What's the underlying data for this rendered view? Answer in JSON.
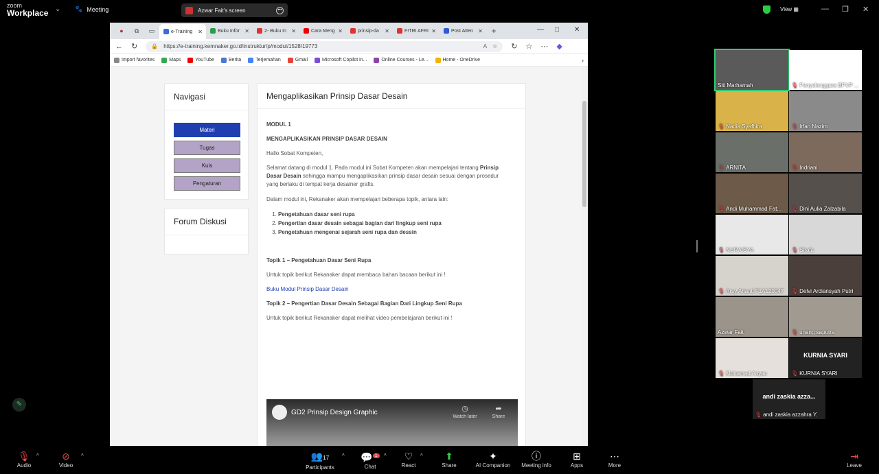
{
  "zoom": {
    "logo_line1": "zoom",
    "logo_line2": "Workplace",
    "meeting_label": "Meeting",
    "screen_share_label": "Azwar Fait's screen",
    "view_label": "View"
  },
  "browser": {
    "tabs": [
      "e-Training",
      "Buku Infor",
      "2- Buku In",
      "Cara Meng",
      "prinsip-da",
      "FITRI AFRI",
      "Post Atten"
    ],
    "url": "https://e-training.kemnaker.go.id/instruktur/p/modul/1528/19773",
    "favorites": [
      "Import favorites",
      "Maps",
      "YouTube",
      "Berita",
      "Terjemahan",
      "Gmail",
      "Microsoft Copilot in...",
      "Online Courses - Le...",
      "Home - OneDrive"
    ]
  },
  "nav_card": {
    "title": "Navigasi",
    "buttons": [
      "Materi",
      "Tugas",
      "Kuis",
      "Pengaturan"
    ]
  },
  "forum_card": {
    "title": "Forum Diskusi"
  },
  "module": {
    "title": "Mengaplikasikan Prinsip Dasar Desain",
    "label": "MODUL 1",
    "heading": "MENGAPLIKASIKAN PRINSIP DASAR DESAIN",
    "greeting": "Hallo Sobat Kompeten,",
    "intro_a": "Selamat datang di modul 1. Pada modul ini Sobat Kompeten akan mempelajari tentang ",
    "intro_b": "Prinsip Dasar Desain",
    "intro_c": " sehingga mampu mengaplikasikan prinsip dasar desain sesuai dengan prosedur yang berlaku di tempat kerja desainer grafis.",
    "topics_intro": "Dalam modul ini, Rekanaker akan mempelajari beberapa topik, antara lain:",
    "topics": [
      "Pengetahuan dasar seni rupa",
      "Pengertian dasar desain sebagai bagian dari lingkup seni rupa",
      "Pengetahuan mengenai sejarah seni rupa dan dessin"
    ],
    "topic1_title": "Topik 1 – Pengetahuan Dasar Seni Rupa",
    "topic1_text": "Untuk topik berikut Rekanaker dapat membaca bahan bacaan berikut ini !",
    "topic1_link": "Buku Modul Prinsip Dasar Desain",
    "topic2_title": "Topik 2 – Pengertian Dasar Desain Sebagai Bagian Dari Lingkup Seni Rupa",
    "topic2_text": "Untuk topik berikut Rekanaker dapat melihat video pembelajaran berikut ini !",
    "video_title": "GD2 Prinsip Design Graphic",
    "watch_later": "Watch later",
    "share": "Share"
  },
  "participants": [
    {
      "name": "Siti Marhamah",
      "muted": false,
      "color": "#5a5a5a"
    },
    {
      "name": "Penyelenggara BPVP ...",
      "muted": true,
      "color": "#ffffff"
    },
    {
      "name": "Nadia Syafhira",
      "muted": true,
      "color": "#d9b34a"
    },
    {
      "name": "Irfan Nazim",
      "muted": true,
      "color": "#8a8a8a"
    },
    {
      "name": "ARNITA",
      "muted": true,
      "color": "#6b6f6a"
    },
    {
      "name": "Indriani",
      "muted": true,
      "color": "#7d6a5c"
    },
    {
      "name": "Andi Muhammad Fat...",
      "muted": true,
      "color": "#6d5a48"
    },
    {
      "name": "Dini Aulia Zalzabila",
      "muted": true,
      "color": "#55504c"
    },
    {
      "name": "NURAISYA",
      "muted": true,
      "color": "#e8e8e8"
    },
    {
      "name": "Shafa",
      "muted": true,
      "color": "#d8d8d8"
    },
    {
      "name": "Arsy Arianti F1A120047",
      "muted": true,
      "color": "#d6d2cc"
    },
    {
      "name": "Delvi Ardiansyah Putri",
      "muted": true,
      "color": "#4a3f3a"
    },
    {
      "name": "Azwar Fait",
      "muted": false,
      "color": "#9a948a"
    },
    {
      "name": "unang saputra",
      "muted": true,
      "color": "#a09a90"
    },
    {
      "name": "Muhamad Ariyac",
      "muted": true,
      "color": "#e5e0dc"
    },
    {
      "name": "KURNIA SYARI",
      "muted": true,
      "color": "#222222",
      "big": "KURNIA SYARI"
    },
    {
      "name": "andi zaskia azzahra Y.",
      "muted": true,
      "color": "#222222",
      "big": "andi zaskia azza..."
    }
  ],
  "bottom": {
    "audio": "Audio",
    "video": "Video",
    "participants": "Participants",
    "participants_count": "17",
    "chat": "Chat",
    "chat_badge": "1",
    "react": "React",
    "share": "Share",
    "ai": "AI Companion",
    "meeting_info": "Meeting info",
    "apps": "Apps",
    "more": "More",
    "leave": "Leave"
  }
}
